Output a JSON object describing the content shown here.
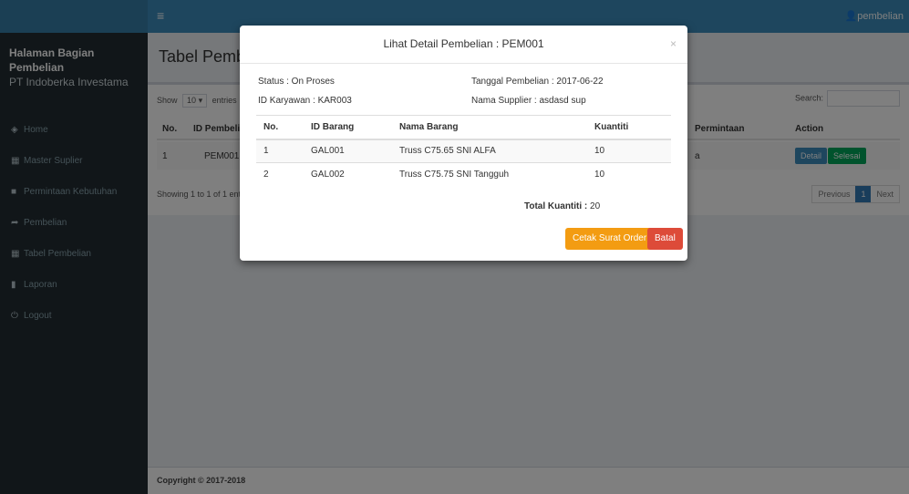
{
  "topbar": {
    "menu_icon": "hamburger-icon",
    "user": "pembelian"
  },
  "sidebar": {
    "title": "Halaman Bagian Pembelian",
    "subtitle": "PT Indoberka Investama",
    "items": [
      {
        "label": "Home",
        "icon": "dashboard-icon"
      },
      {
        "label": "Master Suplier",
        "icon": "table-icon"
      },
      {
        "label": "Permintaan Kebutuhan",
        "icon": "folder-icon"
      },
      {
        "label": "Pembelian",
        "icon": "share-icon"
      },
      {
        "label": "Tabel Pembelian",
        "icon": "table-icon"
      },
      {
        "label": "Laporan",
        "icon": "chart-icon"
      },
      {
        "label": "Logout",
        "icon": "power-icon"
      }
    ]
  },
  "page": {
    "title": "Tabel Pembelian",
    "show_label": "Show",
    "entries_value": "10",
    "entries_label": "entries",
    "search_label": "Search:",
    "columns": [
      "No.",
      "ID Pembelian",
      "Permintaan",
      "Action"
    ],
    "row": {
      "no": "1",
      "id": "PEM001",
      "permintaan": "a"
    },
    "btn_detail": "Detail",
    "btn_selesai": "Selesai",
    "info": "Showing 1 to 1 of 1 entries",
    "pager": {
      "prev": "Previous",
      "page": "1",
      "next": "Next"
    }
  },
  "footer": {
    "copyright": "Copyright © 2017-2018"
  },
  "modal": {
    "title": "Lihat Detail Pembelian : PEM001",
    "status": "Status : On Proses",
    "tanggal": "Tanggal Pembelian : 2017-06-22",
    "karyawan": "ID Karyawan : KAR003",
    "supplier": "Nama Supplier : asdasd sup",
    "columns": [
      "No.",
      "ID Barang",
      "Nama Barang",
      "Kuantiti"
    ],
    "rows": [
      {
        "no": "1",
        "id": "GAL001",
        "nama": "Truss C75.65 SNI ALFA",
        "qty": "10"
      },
      {
        "no": "2",
        "id": "GAL002",
        "nama": "Truss C75.75 SNI Tangguh",
        "qty": "10"
      }
    ],
    "total_label": "Total Kuantiti :",
    "total_value": "20",
    "btn_cetak": "Cetak Surat Order",
    "btn_batal": "Batal",
    "close": "×"
  },
  "colors": {
    "navbar": "#3c8dbc",
    "sidebar": "#222d32",
    "orange": "#f39c12",
    "red": "#dd4b39",
    "green": "#00a65a",
    "blue": "#3c8dbc"
  }
}
